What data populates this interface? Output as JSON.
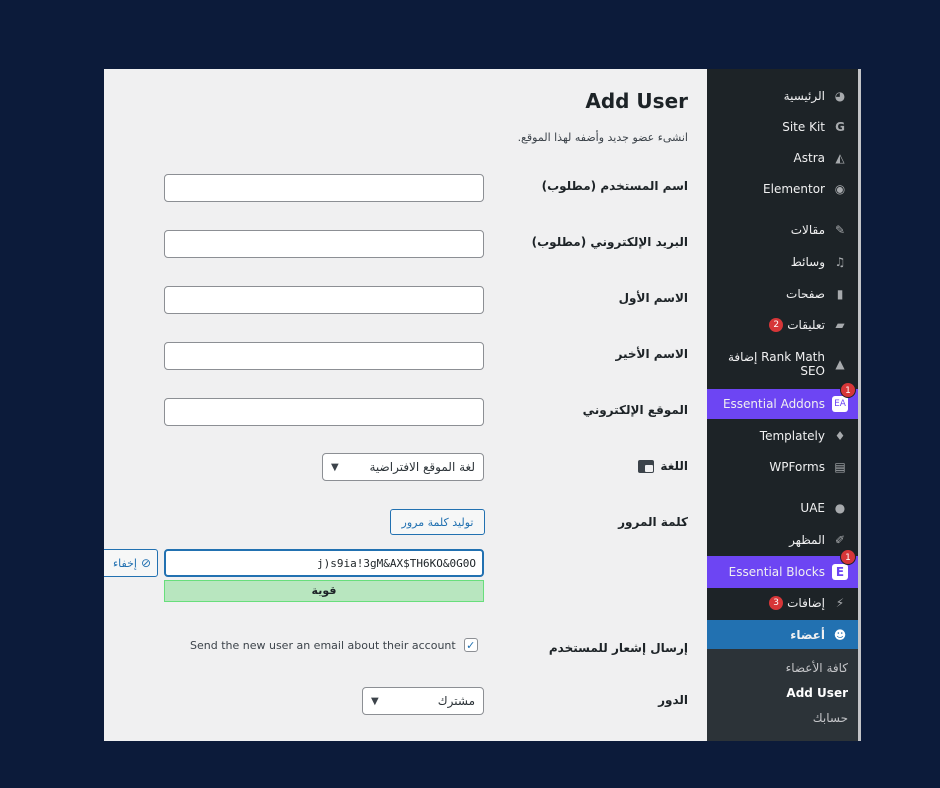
{
  "sidebar": {
    "items": [
      {
        "label": "الرئيسية",
        "icon": "dashboard-icon"
      },
      {
        "label": "Site Kit",
        "icon": "google-g-icon"
      },
      {
        "label": "Astra",
        "icon": "astra-icon"
      },
      {
        "label": "Elementor",
        "icon": "elementor-icon"
      },
      {
        "label": "مقالات",
        "icon": "pin-icon"
      },
      {
        "label": "وسائط",
        "icon": "media-icon"
      },
      {
        "label": "صفحات",
        "icon": "page-icon"
      },
      {
        "label": "تعليقات",
        "icon": "comment-icon",
        "badge": "2"
      },
      {
        "label": "إضافة Rank Math SEO",
        "icon": "rank-math-icon"
      },
      {
        "label": "Essential Addons",
        "icon": "ea-icon",
        "badge": "1"
      },
      {
        "label": "Templately",
        "icon": "templately-icon"
      },
      {
        "label": "WPForms",
        "icon": "wpforms-icon"
      },
      {
        "label": "UAE",
        "icon": "uae-icon"
      },
      {
        "label": "المظهر",
        "icon": "brush-icon"
      },
      {
        "label": "Essential Blocks",
        "icon": "eb-icon",
        "badge": "1"
      },
      {
        "label": "إضافات",
        "icon": "plugin-icon",
        "badge": "3"
      },
      {
        "label": "أعضاء",
        "icon": "users-icon"
      }
    ],
    "submenu": [
      "كافة الأعضاء",
      "Add User",
      "حسابك"
    ]
  },
  "page": {
    "title": "Add User",
    "subtitle": "انشىء عضو جديد وأضفه لهذا الموقع."
  },
  "form": {
    "username_label": "اسم المستخدم (مطلوب)",
    "email_label": "البريد الإلكتروني (مطلوب)",
    "first_name_label": "الاسم الأول",
    "last_name_label": "الاسم الأخير",
    "website_label": "الموقع الإلكتروني",
    "language_label": "اللغة",
    "language_value": "لغة الموقع الافتراضية",
    "password_label": "كلمة المرور",
    "generate_password_button": "توليد كلمة مرور",
    "password_value": "j)s9ia!3gM&AX$TH6KO&0G0O",
    "hide_button": "إخفاء",
    "strength": "قوية",
    "notify_label": "إرسال إشعار للمستخدم",
    "notify_text": "Send the new user an email about their account",
    "notify_checked": true,
    "role_label": "الدور",
    "role_value": "مشترك"
  },
  "colors": {
    "background": "#0c1b3a",
    "sidebar": "#1d2327",
    "purple": "#6d45f3",
    "active": "#2271b1",
    "badge": "#d63638",
    "strength_bg": "#b8e6bf"
  }
}
